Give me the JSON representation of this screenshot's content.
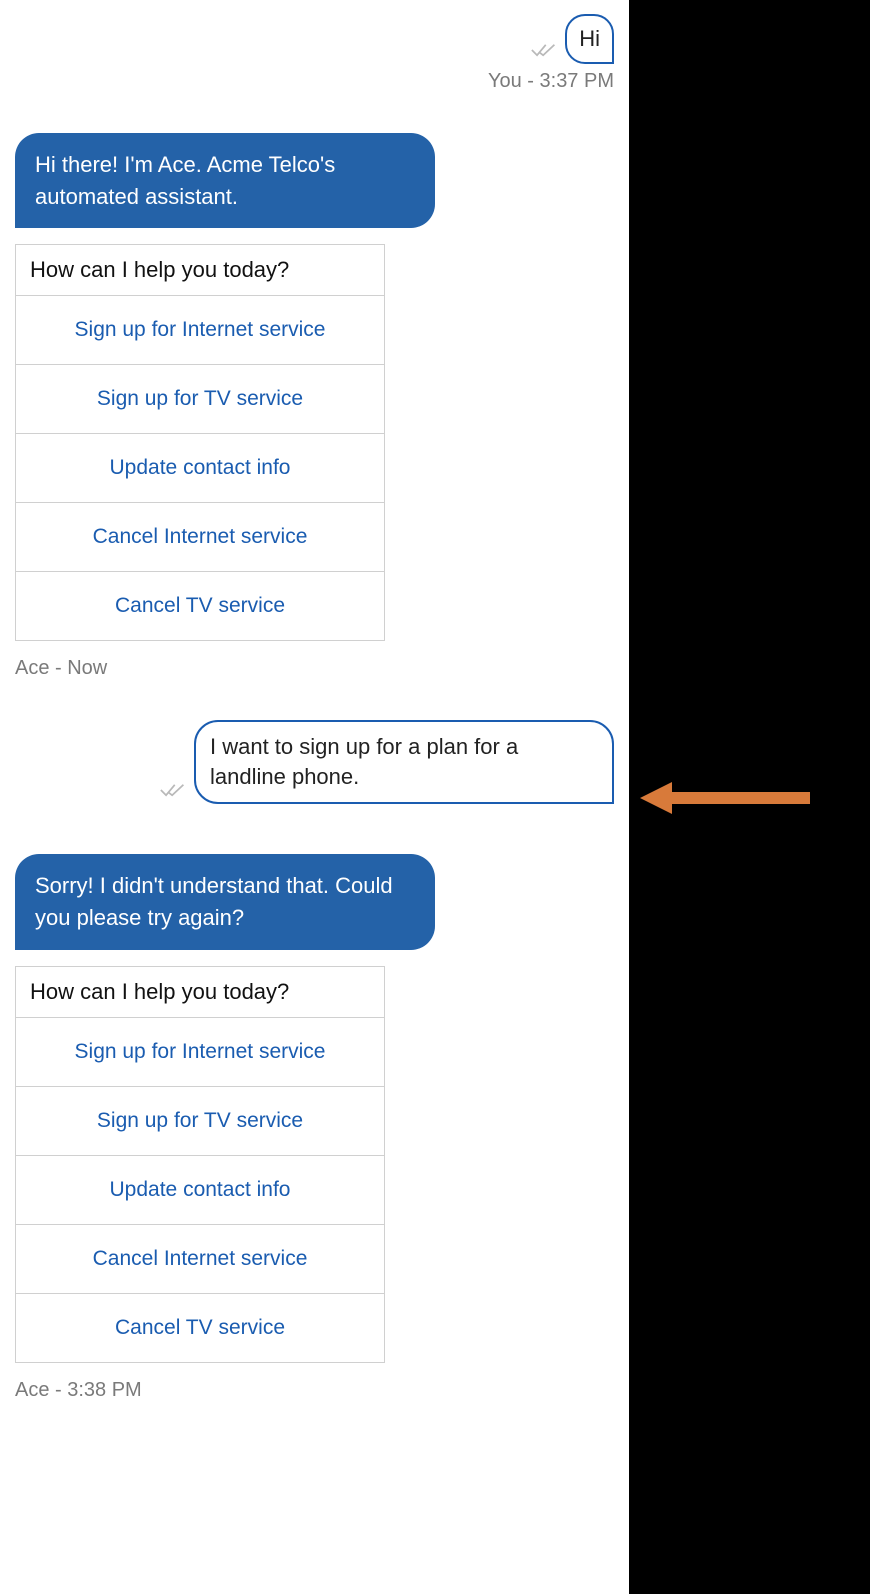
{
  "messages": [
    {
      "type": "user",
      "text": "Hi",
      "meta": "You - 3:37 PM"
    },
    {
      "type": "bot",
      "text": "Hi there! I'm Ace. Acme Telco's automated assistant.",
      "options_header": "How can I help you today?",
      "options": [
        "Sign up for Internet service",
        "Sign up for TV service",
        "Update contact info",
        "Cancel Internet service",
        "Cancel TV service"
      ],
      "meta": "Ace - Now"
    },
    {
      "type": "user",
      "text": "I want to sign up for a plan for a landline phone."
    },
    {
      "type": "bot",
      "text": "Sorry! I didn't understand that. Could you please try again?",
      "options_header": "How can I help you today?",
      "options": [
        "Sign up for Internet service",
        "Sign up for TV service",
        "Update contact info",
        "Cancel Internet service",
        "Cancel TV service"
      ],
      "meta": "Ace - 3:38 PM"
    }
  ],
  "arrow_color": "#d87a3a"
}
